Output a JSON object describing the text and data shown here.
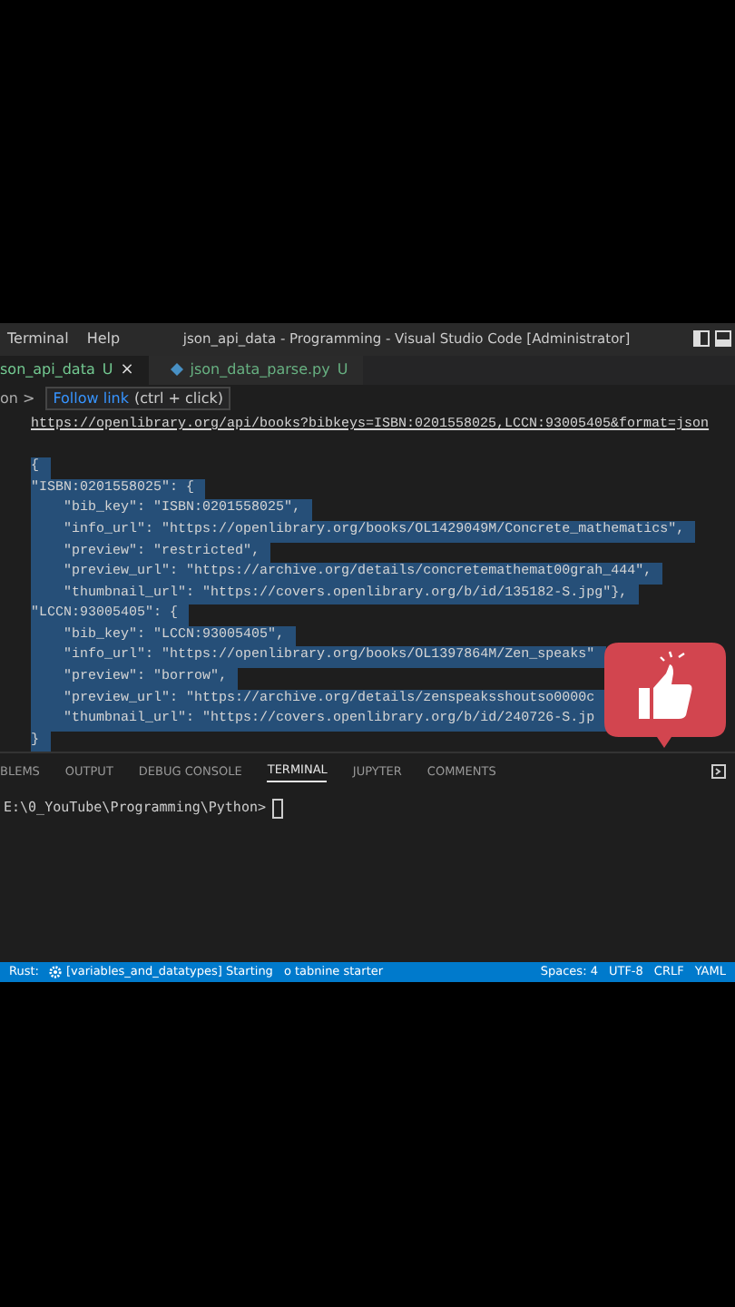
{
  "menu": [
    "Terminal",
    "Help"
  ],
  "window": {
    "title": "json_api_data - Programming - Visual Studio Code [Administrator]"
  },
  "tabs": [
    {
      "label": "son_api_data",
      "status": "U",
      "close": "×",
      "kind": "json",
      "selected": true
    },
    {
      "label": "json_data_parse.py",
      "status": "U",
      "kind": "python",
      "selected": false
    }
  ],
  "breadcrumb": "on >",
  "tooltip": {
    "link": "Follow link",
    "hint": "(ctrl + click)"
  },
  "editor_lines": [
    {
      "text": "https://openlibrary.org/api/books?bibkeys=ISBN:0201558025,LCCN:93005405&format=json",
      "kind": "link",
      "selected": false
    },
    {
      "text": "{",
      "kind": "code",
      "selected": true
    },
    {
      "text": "\"ISBN:0201558025\": {",
      "kind": "code",
      "selected": true
    },
    {
      "text": "    \"bib_key\": \"ISBN:0201558025\",",
      "kind": "code",
      "selected": true
    },
    {
      "text": "    \"info_url\": \"https://openlibrary.org/books/OL1429049M/Concrete_mathematics\",",
      "kind": "code",
      "selected": true
    },
    {
      "text": "    \"preview\": \"restricted\",",
      "kind": "code",
      "selected": true
    },
    {
      "text": "    \"preview_url\": \"https://archive.org/details/concretemathemat00grah_444\",",
      "kind": "code",
      "selected": true
    },
    {
      "text": "    \"thumbnail_url\": \"https://covers.openlibrary.org/b/id/135182-S.jpg\"},",
      "kind": "code",
      "selected": true
    },
    {
      "text": "\"LCCN:93005405\": {",
      "kind": "code",
      "selected": true
    },
    {
      "text": "    \"bib_key\": \"LCCN:93005405\",",
      "kind": "code",
      "selected": true
    },
    {
      "text": "    \"info_url\": \"https://openlibrary.org/books/OL1397864M/Zen_speaks\"",
      "kind": "code",
      "selected": true
    },
    {
      "text": "    \"preview\": \"borrow\",",
      "kind": "code",
      "selected": true
    },
    {
      "text": "    \"preview_url\": \"https://archive.org/details/zenspeaksshoutso0000c",
      "kind": "code",
      "selected": true
    },
    {
      "text": "    \"thumbnail_url\": \"https://covers.openlibrary.org/b/id/240726-S.jp",
      "kind": "code",
      "selected": true
    },
    {
      "text": "}",
      "kind": "code",
      "selected": true
    }
  ],
  "panel_tabs": [
    {
      "label": "BLEMS",
      "selected": false
    },
    {
      "label": "OUTPUT",
      "selected": false
    },
    {
      "label": "DEBUG CONSOLE",
      "selected": false
    },
    {
      "label": "TERMINAL",
      "selected": true
    },
    {
      "label": "JUPYTER",
      "selected": false
    },
    {
      "label": "COMMENTS",
      "selected": false
    }
  ],
  "terminal": {
    "prompt": "E:\\0_YouTube\\Programming\\Python>"
  },
  "status_bar": {
    "left": [
      {
        "text": "Rust:",
        "kind": "text"
      },
      {
        "text": "[variables_and_datatypes] Starting",
        "kind": "gear"
      },
      {
        "text": "o tabnine starter",
        "kind": "text"
      }
    ],
    "right": [
      "Spaces: 4",
      "UTF-8",
      "CRLF",
      "YAML"
    ]
  }
}
